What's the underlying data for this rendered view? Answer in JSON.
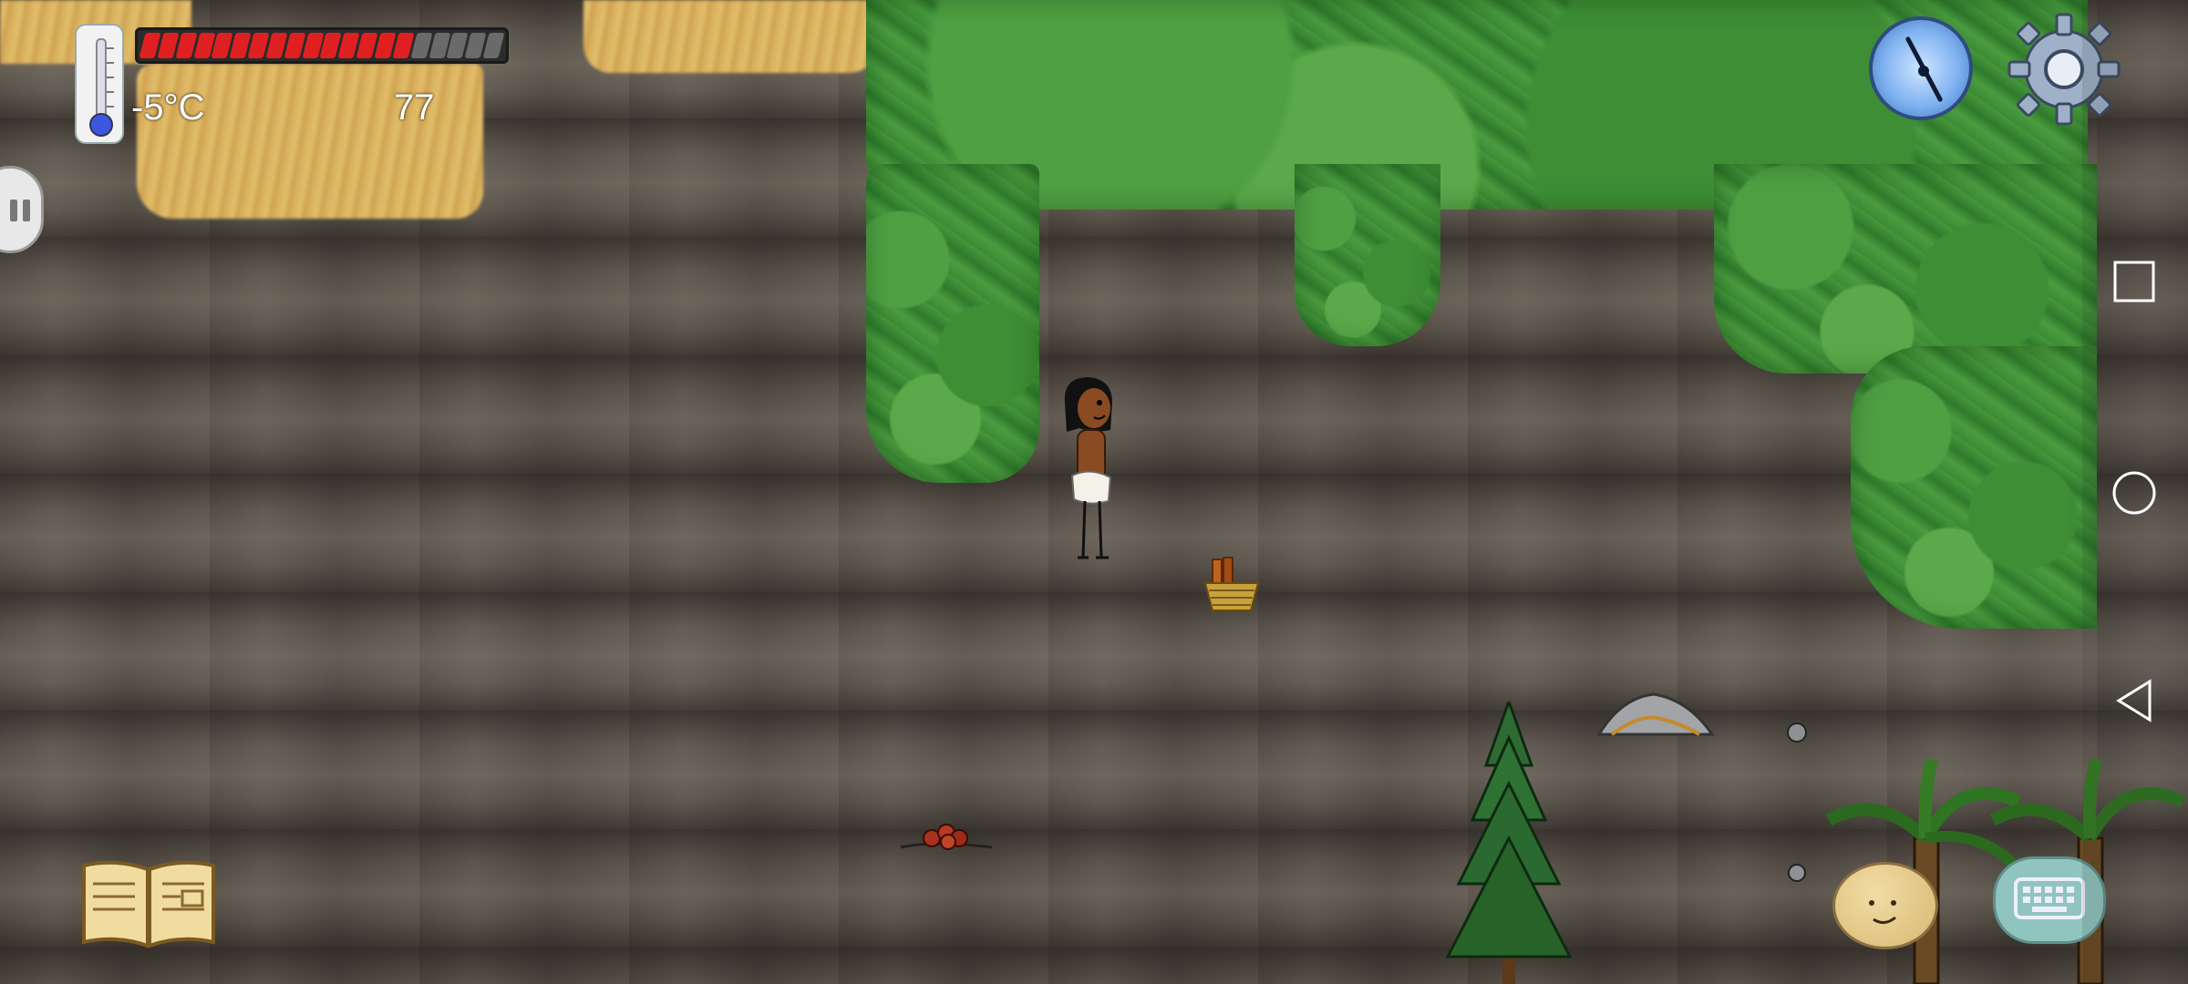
{
  "hud": {
    "temperature": "-5°C",
    "food_count": "77",
    "food_bar": {
      "total_pips": 20,
      "filled_pips": 15,
      "filled_color": "#e02020",
      "empty_color": "#6a6a6a"
    },
    "thermometer_icon": "thermometer-icon",
    "compass_icon": "compass-icon",
    "settings_icon": "gear-icon",
    "pause_icon": "pause-icon",
    "journal_icon": "open-book-icon",
    "emote_icon": "smiley-face-icon",
    "keyboard_icon": "keyboard-speech-bubble-icon"
  },
  "world": {
    "player": "child-character",
    "items": [
      "basket",
      "rock-pile",
      "round-stone",
      "round-stone-small",
      "berry-pile",
      "pine-tree",
      "palm-tree",
      "palm-tree"
    ]
  },
  "android_nav": {
    "recent_icon": "square-icon",
    "home_icon": "circle-icon",
    "back_icon": "triangle-back-icon"
  }
}
